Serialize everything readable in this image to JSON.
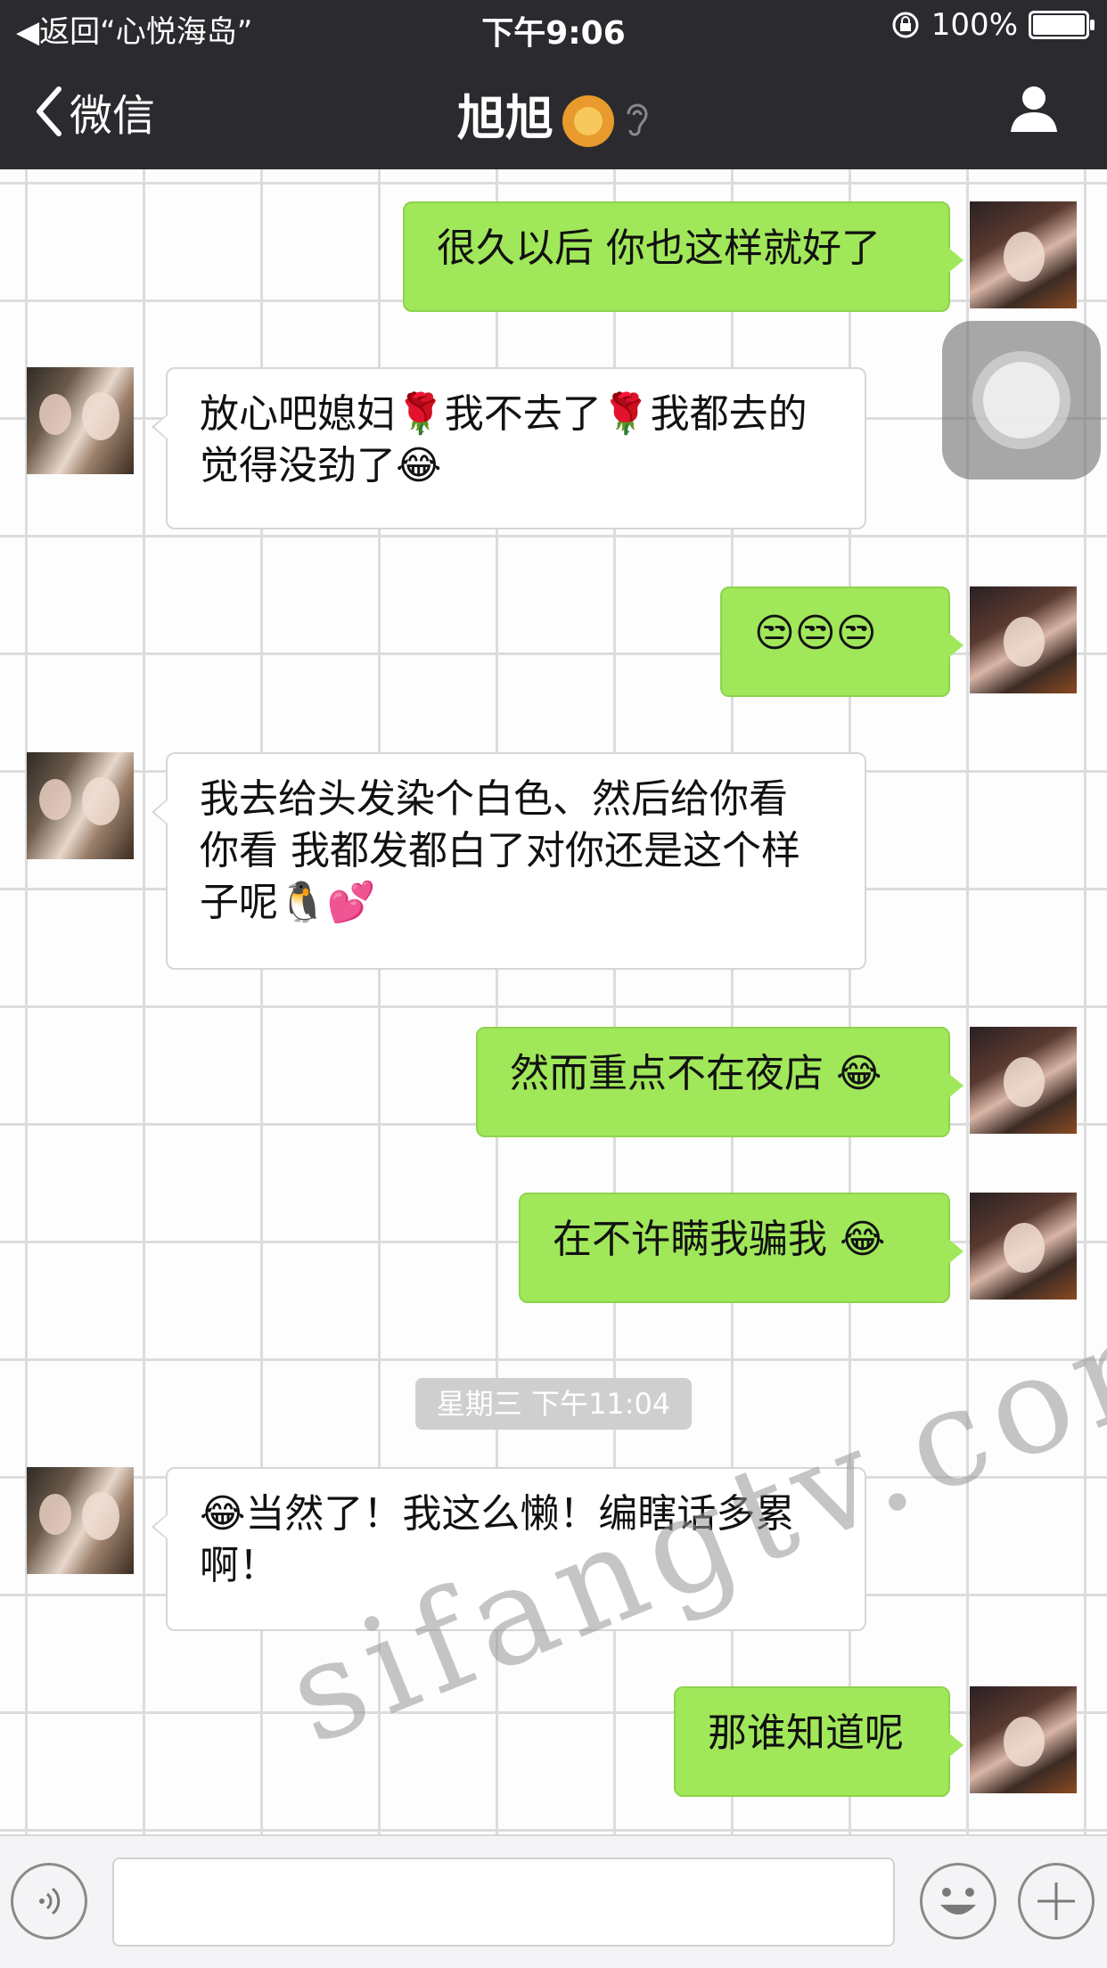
{
  "status_bar": {
    "back_app": "返回“心悦海岛”",
    "time": "下午9:06",
    "battery": "100%",
    "battery_level": 1.0
  },
  "nav": {
    "back_label": "微信",
    "title": "旭旭"
  },
  "messages": [
    {
      "side": "out",
      "text": "很久以后 你也这样就好了"
    },
    {
      "side": "in",
      "text": "放心吧媳妇🌹我不去了🌹我都去的觉得没劲了😂"
    },
    {
      "side": "out",
      "text": "😒😒😒"
    },
    {
      "side": "in",
      "text": "我去给头发染个白色、然后给你看 你看 我都发都白了对你还是这个样子呢🐧💕"
    },
    {
      "side": "out",
      "text": "然而重点不在夜店 😂"
    },
    {
      "side": "out",
      "text": "在不许瞒我骗我 😂"
    },
    {
      "side": "in",
      "text": "😂当然了！我这么懒！编瞎话多累啊！"
    },
    {
      "side": "out",
      "text": "那谁知道呢"
    }
  ],
  "timestamp": "星期三 下午11:04",
  "watermark": "sifangtv.com",
  "icons": {
    "status_left": "triangle-left-icon",
    "lock": "rotation-lock-icon",
    "back": "chevron-left-icon",
    "ear": "ear-icon",
    "profile": "person-icon",
    "voice": "voice-icon",
    "emoji": "smiley-icon",
    "plus": "plus-icon"
  },
  "colors": {
    "nav_bg": "#2b2b2f",
    "bubble_out": "#a0e75a",
    "bubble_in": "#ffffff"
  }
}
